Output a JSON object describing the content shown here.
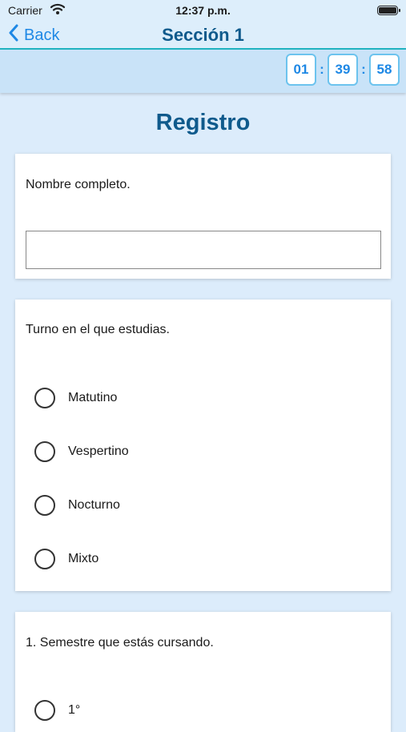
{
  "status_bar": {
    "carrier": "Carrier",
    "time": "12:37 p.m."
  },
  "nav": {
    "back_label": "Back",
    "title": "Sección 1"
  },
  "timer": {
    "hours": "01",
    "minutes": "39",
    "seconds": "58",
    "separator": ":"
  },
  "page": {
    "title": "Registro"
  },
  "questions": [
    {
      "text": "Nombre completo.",
      "type": "text",
      "value": ""
    },
    {
      "text": "Turno en el que estudias.",
      "type": "radio",
      "options": [
        "Matutino",
        "Vespertino",
        "Nocturno",
        "Mixto"
      ],
      "selected": null
    },
    {
      "text": "1. Semestre que estás cursando.",
      "type": "radio",
      "options": [
        "1°"
      ],
      "selected": null
    }
  ],
  "icons": {
    "back": "chevron-left-icon",
    "wifi": "wifi-icon",
    "battery": "battery-icon",
    "radio": "radio-unselected-icon"
  },
  "colors": {
    "accent": "#1e88e5",
    "title": "#0f5a8c",
    "divider": "#21b3c0",
    "background": "#dcecfb"
  }
}
